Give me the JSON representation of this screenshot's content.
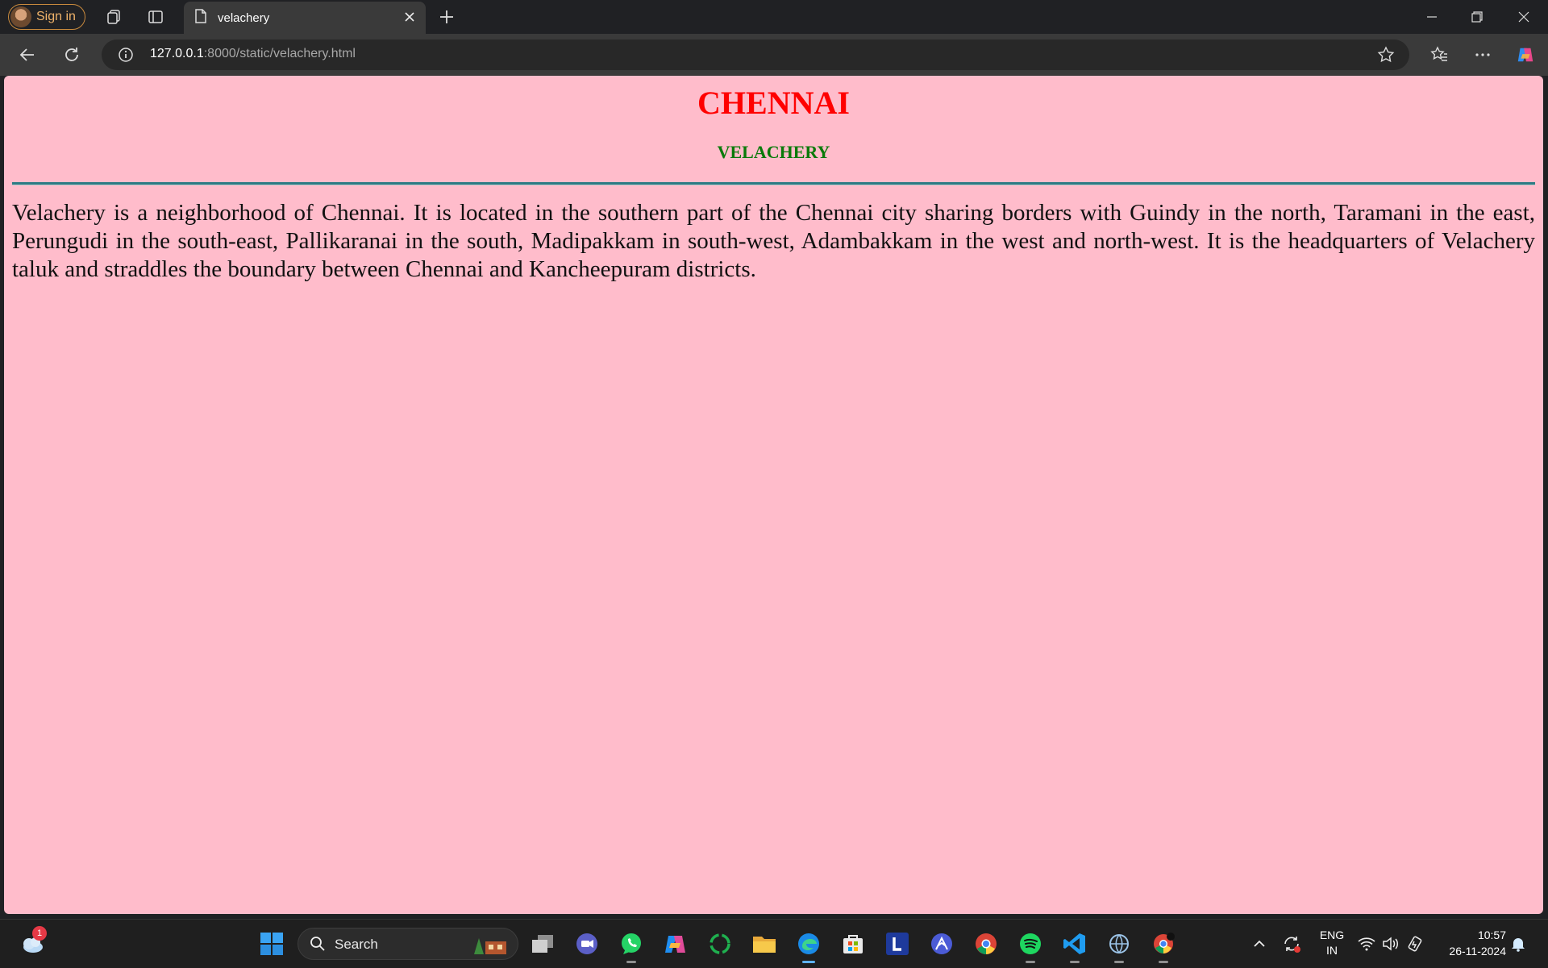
{
  "browser": {
    "signin_label": "Sign in",
    "tab_title": "velachery",
    "url_host": "127.0.0.1",
    "url_rest": ":8000/static/velachery.html"
  },
  "page": {
    "heading": "CHENNAI",
    "subheading": "VELACHERY",
    "paragraph": "Velachery is a neighborhood of Chennai. It is located in the southern part of the Chennai city sharing borders with Guindy in the north, Taramani in the east, Perungudi in the south-east, Pallikaranai in the south, Madipakkam in south-west, Adambakkam in the west and north-west. It is the headquarters of Velachery taluk and straddles the boundary between Chennai and Kancheepuram districts.",
    "background_color": "#ffbccb",
    "heading_color": "#ff0000",
    "subheading_color": "#0a7a0a"
  },
  "taskbar": {
    "weather_badge": "1",
    "search_label": "Search",
    "language_line1": "ENG",
    "language_line2": "IN",
    "time": "10:57",
    "date": "26-11-2024",
    "apps": [
      "windows-start",
      "search",
      "task-view",
      "meet",
      "whatsapp",
      "copilot",
      "circle-app",
      "file-explorer",
      "edge",
      "store",
      "l-app",
      "arc-app",
      "chrome",
      "spotify",
      "vscode",
      "globe-app",
      "chrome-profile"
    ]
  }
}
